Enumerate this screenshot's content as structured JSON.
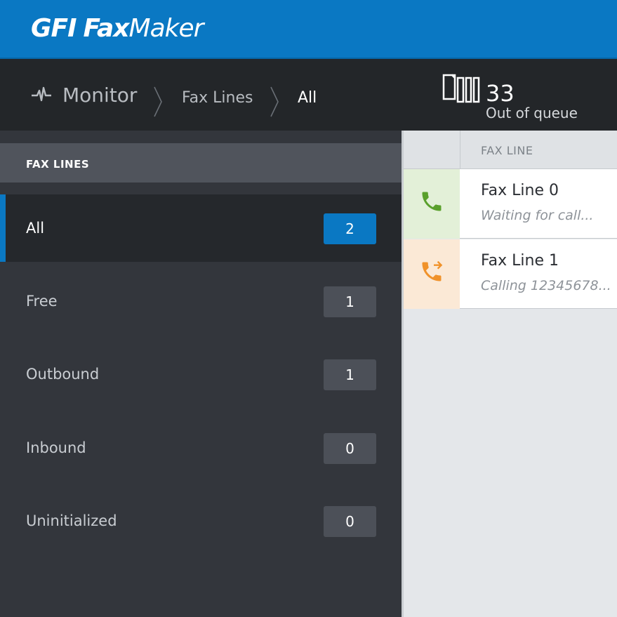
{
  "brand": {
    "part1": "GFI",
    "part2": "Fax",
    "part3": "Maker"
  },
  "breadcrumb": {
    "icon": "pulse-icon",
    "items": [
      "Monitor",
      "Fax Lines",
      "All"
    ]
  },
  "queue": {
    "icon": "fax-pages-icon",
    "count": "33",
    "label": "Out of queue"
  },
  "sidebar": {
    "section_title": "FAX LINES",
    "items": [
      {
        "label": "All",
        "count": "2",
        "active": true
      },
      {
        "label": "Free",
        "count": "1"
      },
      {
        "label": "Outbound",
        "count": "1"
      },
      {
        "label": "Inbound",
        "count": "0"
      },
      {
        "label": "Uninitialized",
        "count": "0"
      }
    ]
  },
  "table": {
    "column": "FAX LINE",
    "rows": [
      {
        "title": "Fax Line 0",
        "status": "Waiting for call...",
        "icon": "phone-icon",
        "color": "#5aa02c",
        "bg": "#e3f0d8"
      },
      {
        "title": "Fax Line 1",
        "status": "Calling 12345678...",
        "icon": "phone-outgoing-icon",
        "color": "#f0922a",
        "bg": "#fbe9d6"
      }
    ]
  },
  "colors": {
    "accent": "#0a78c3",
    "header": "#232629",
    "sidebar": "#33363c"
  }
}
